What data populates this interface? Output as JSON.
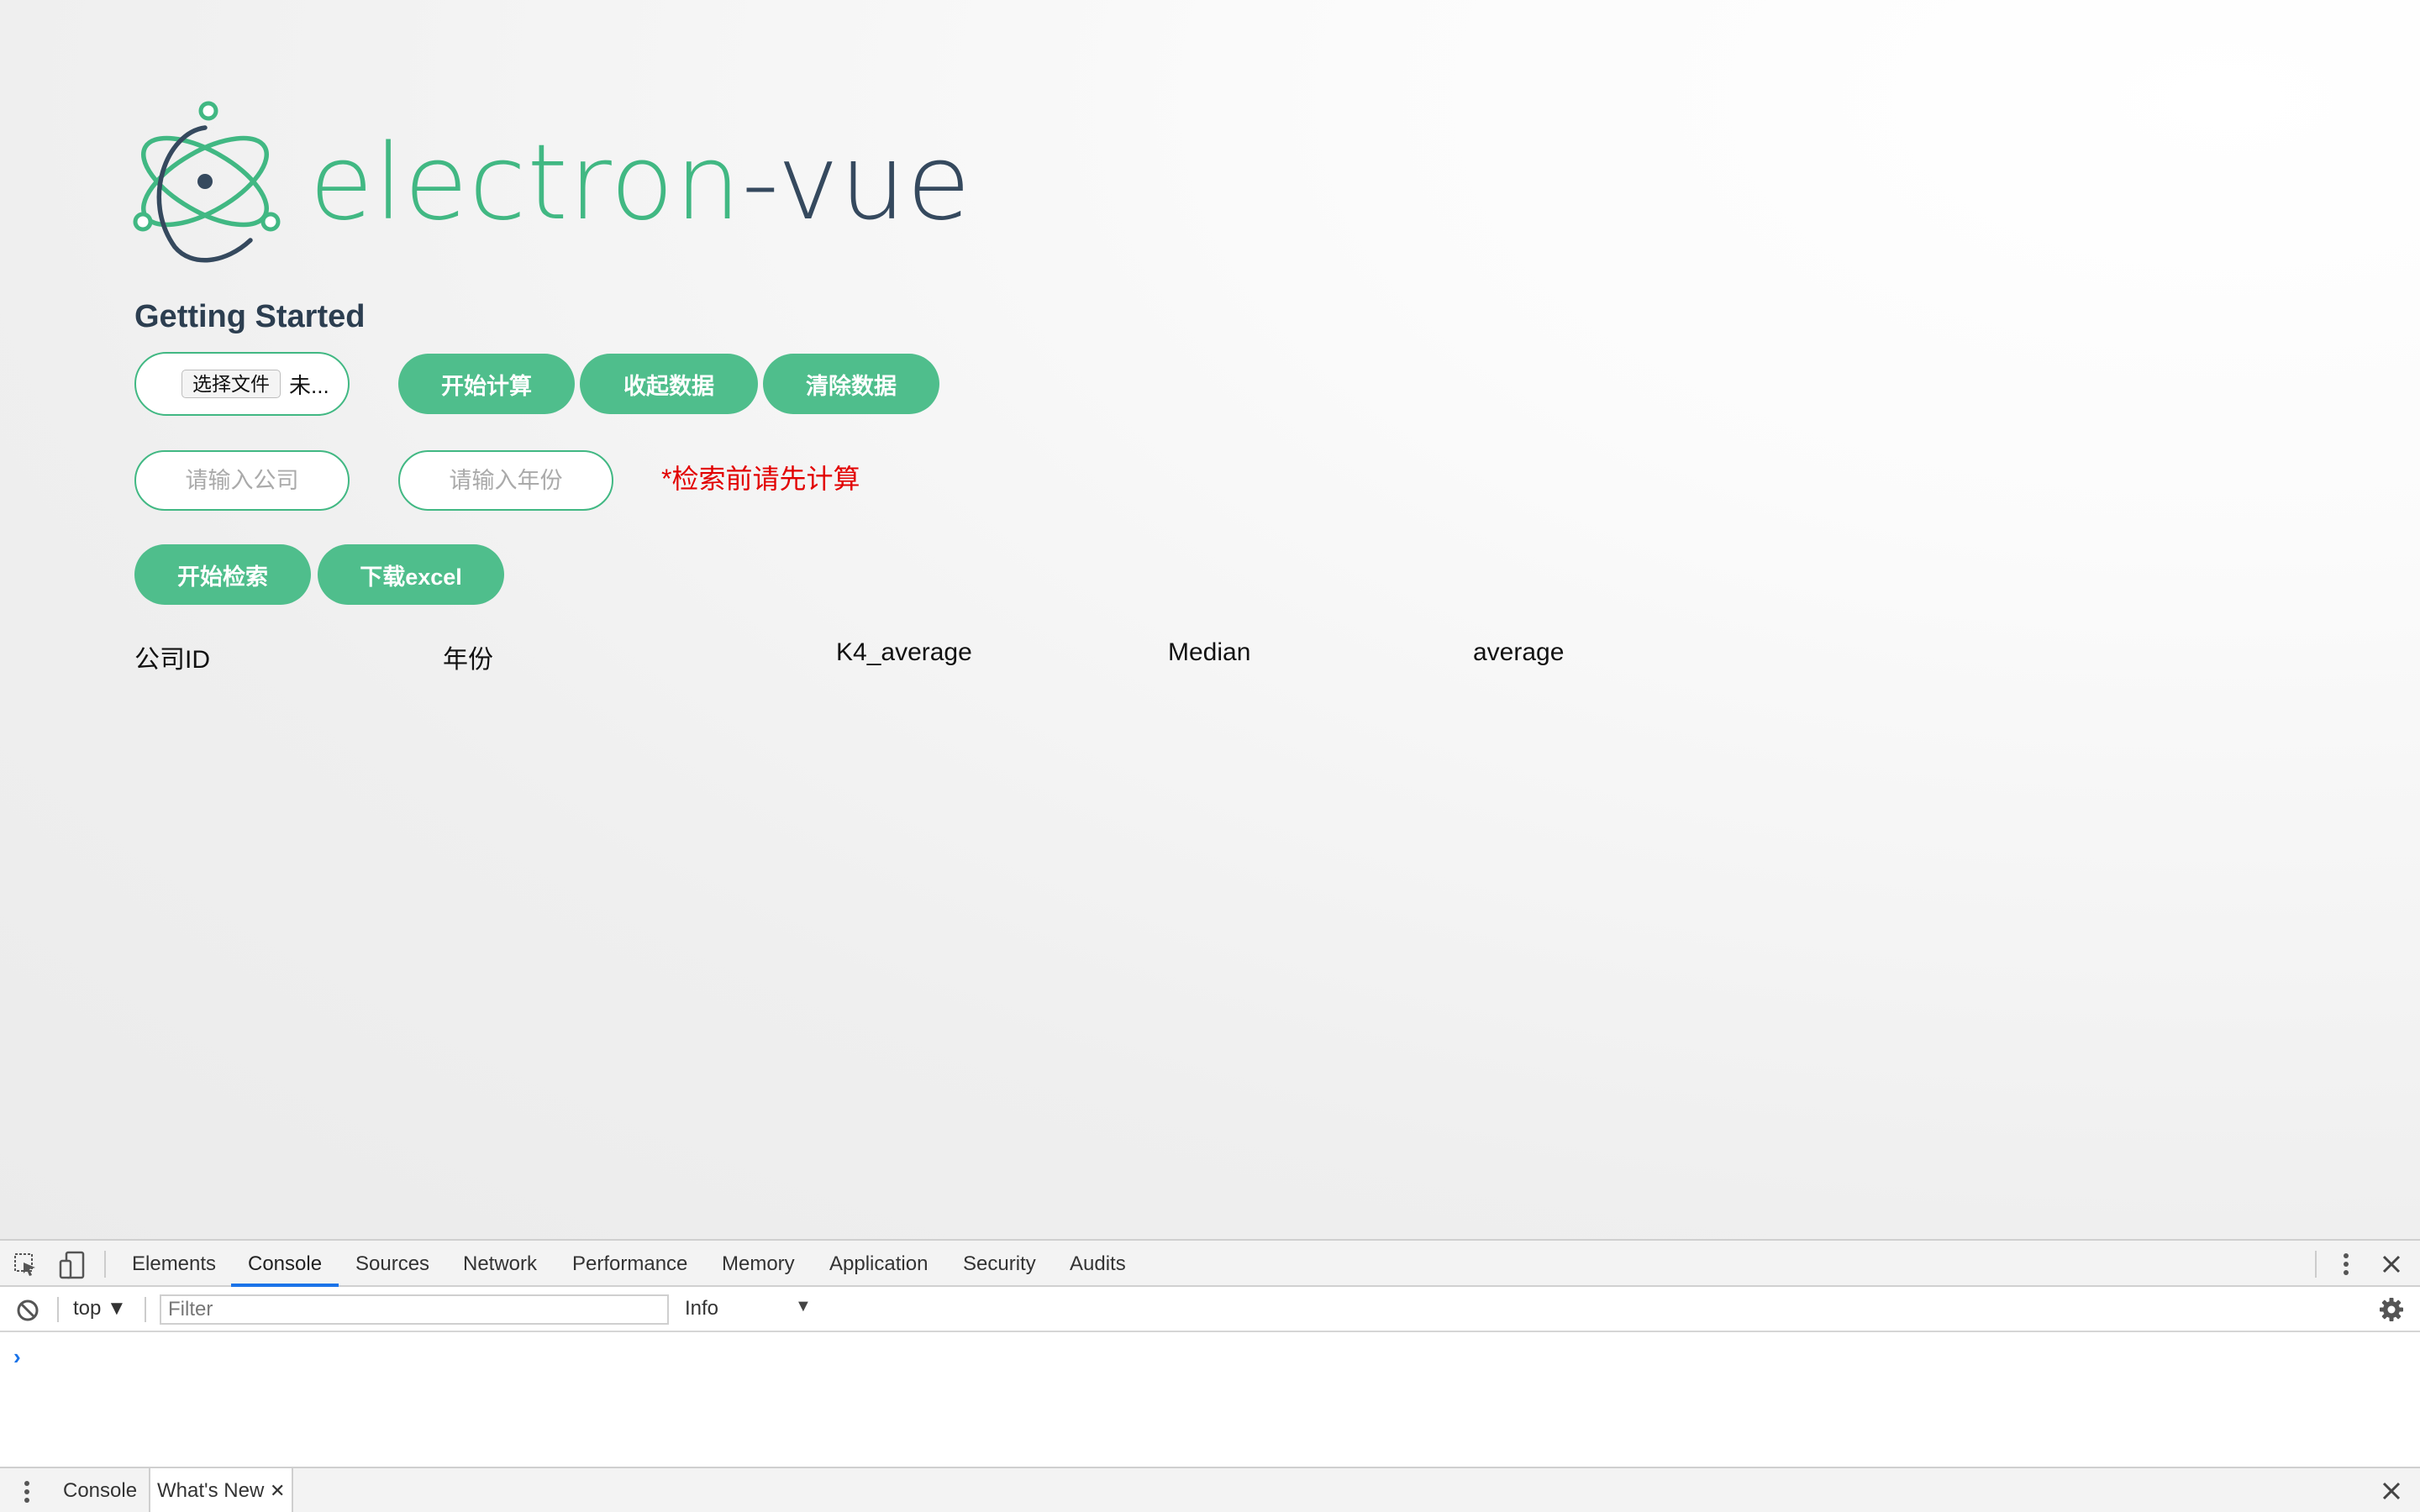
{
  "logo": {
    "text_part1": "electron",
    "text_part2": "-vue",
    "brand_green": "#41b883",
    "brand_navy": "#35495e",
    "icon": "electron-atom-icon"
  },
  "title": "Getting Started",
  "file_input": {
    "button_label": "选择文件",
    "status": "未..."
  },
  "buttons": {
    "calculate": "开始计算",
    "collapse": "收起数据",
    "clear": "清除数据",
    "search": "开始检索",
    "download": "下载excel"
  },
  "inputs": {
    "company_placeholder": "请输入公司",
    "year_placeholder": "请输入年份"
  },
  "warning": "*检索前请先计算",
  "table": {
    "columns": [
      "公司ID",
      "年份",
      "K4_average",
      "Median",
      "average"
    ]
  },
  "devtools": {
    "tabs": [
      "Elements",
      "Console",
      "Sources",
      "Network",
      "Performance",
      "Memory",
      "Application",
      "Security",
      "Audits"
    ],
    "active_tab": "Console",
    "context": "top",
    "filter_placeholder": "Filter",
    "level": "Info",
    "prompt": "›",
    "drawer_tabs": [
      "Console",
      "What's New"
    ]
  },
  "colors": {
    "button_green": "#4fbe8c",
    "warning_red": "#e20000",
    "devtools_blue": "#1a73e8"
  }
}
